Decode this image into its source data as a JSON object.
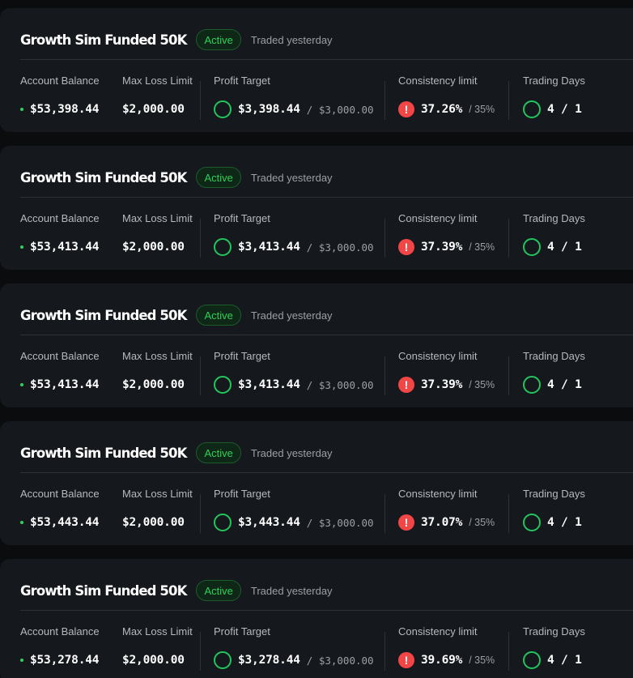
{
  "labels": {
    "account_balance": "Account Balance",
    "max_loss_limit": "Max Loss Limit",
    "profit_target": "Profit Target",
    "consistency_limit": "Consistency limit",
    "trading_days": "Trading Days",
    "alert_glyph": "!"
  },
  "colors": {
    "background": "#0a0c0e",
    "card": "#15181c",
    "accent_green": "#22c55e",
    "alert_red": "#f24646"
  },
  "accounts": [
    {
      "name": "Growth Sim Funded 50K",
      "status": "Active",
      "last_traded": "Traded yesterday",
      "account_balance": "$53,398.44",
      "max_loss_limit": "$2,000.00",
      "profit_current": "$3,398.44",
      "profit_target": "/ $3,000.00",
      "consistency_current": "37.26%",
      "consistency_limit": "/ 35%",
      "trading_days": "4 / 1"
    },
    {
      "name": "Growth Sim Funded 50K",
      "status": "Active",
      "last_traded": "Traded yesterday",
      "account_balance": "$53,413.44",
      "max_loss_limit": "$2,000.00",
      "profit_current": "$3,413.44",
      "profit_target": "/ $3,000.00",
      "consistency_current": "37.39%",
      "consistency_limit": "/ 35%",
      "trading_days": "4 / 1"
    },
    {
      "name": "Growth Sim Funded 50K",
      "status": "Active",
      "last_traded": "Traded yesterday",
      "account_balance": "$53,413.44",
      "max_loss_limit": "$2,000.00",
      "profit_current": "$3,413.44",
      "profit_target": "/ $3,000.00",
      "consistency_current": "37.39%",
      "consistency_limit": "/ 35%",
      "trading_days": "4 / 1"
    },
    {
      "name": "Growth Sim Funded 50K",
      "status": "Active",
      "last_traded": "Traded yesterday",
      "account_balance": "$53,443.44",
      "max_loss_limit": "$2,000.00",
      "profit_current": "$3,443.44",
      "profit_target": "/ $3,000.00",
      "consistency_current": "37.07%",
      "consistency_limit": "/ 35%",
      "trading_days": "4 / 1"
    },
    {
      "name": "Growth Sim Funded 50K",
      "status": "Active",
      "last_traded": "Traded yesterday",
      "account_balance": "$53,278.44",
      "max_loss_limit": "$2,000.00",
      "profit_current": "$3,278.44",
      "profit_target": "/ $3,000.00",
      "consistency_current": "39.69%",
      "consistency_limit": "/ 35%",
      "trading_days": "4 / 1"
    }
  ]
}
